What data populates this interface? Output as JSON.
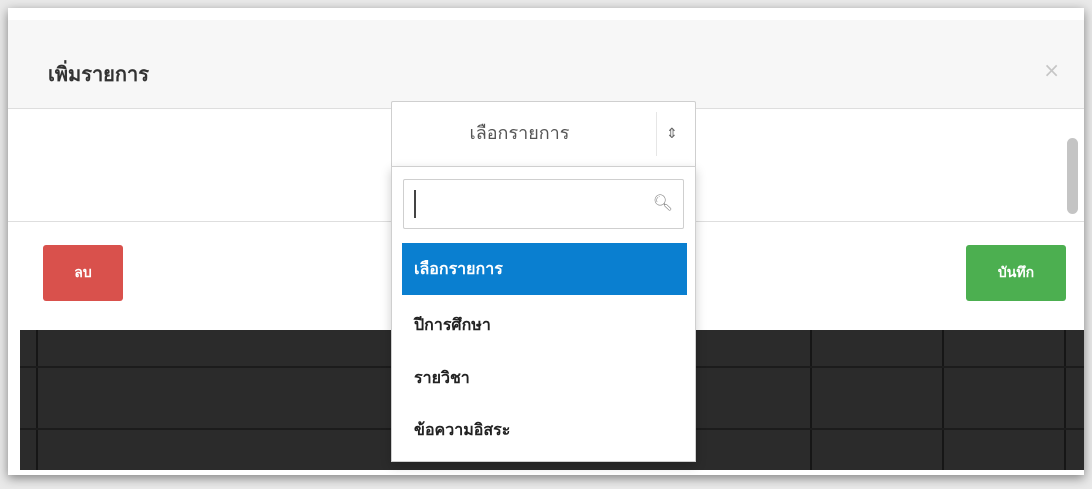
{
  "modal": {
    "title": "เพิ่มรายการ",
    "close_label": "×"
  },
  "select": {
    "value": "เลือกรายการ",
    "arrows": "⇕"
  },
  "dropdown": {
    "search_value": "",
    "search_icon": "magnifier-icon",
    "options": [
      {
        "label": "เลือกรายการ",
        "selected": true
      },
      {
        "label": "ปีการศึกษา",
        "selected": false
      },
      {
        "label": "รายวิชา",
        "selected": false
      },
      {
        "label": "ข้อความอิสระ",
        "selected": false
      }
    ]
  },
  "buttons": {
    "delete_label": "ลบ",
    "save_label": "บันทึก"
  },
  "colors": {
    "selected_option": "#0a7fd0",
    "delete_button": "#d9514c",
    "save_button": "#4caf50",
    "table_background": "#2b2b2b"
  }
}
